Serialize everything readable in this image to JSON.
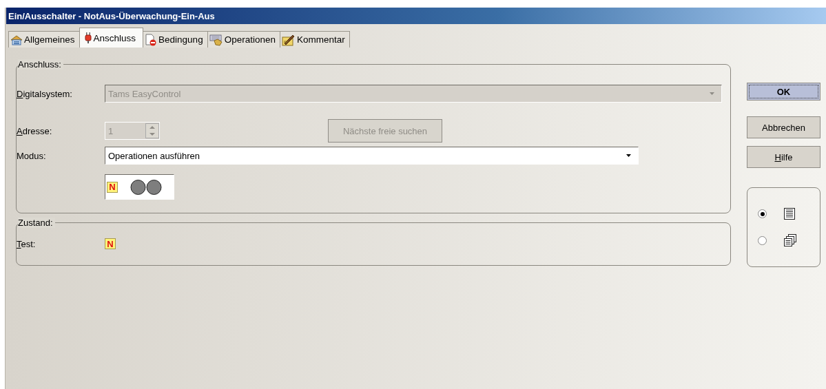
{
  "window": {
    "title": "Ein/Ausschalter - NotAus-Überwachung-Ein-Aus"
  },
  "tabs": [
    {
      "label": "Allgemeines",
      "kind": "general",
      "selected": false
    },
    {
      "label": "Anschluss",
      "kind": "plug",
      "selected": true
    },
    {
      "label": "Bedingung",
      "kind": "condition",
      "selected": false
    },
    {
      "label": "Operationen",
      "kind": "operations",
      "selected": false
    },
    {
      "label": "Kommentar",
      "kind": "comment",
      "selected": false
    }
  ],
  "connection": {
    "title": "Anschluss:",
    "digital_system": {
      "label": "Digitalsystem:",
      "underline_first": true,
      "value": "Tams EasyControl",
      "disabled": true
    },
    "address": {
      "label": "Adresse:",
      "underline_first": true,
      "value": "1",
      "disabled": true
    },
    "find_free_button": {
      "label": "Nächste freie suchen",
      "disabled": true
    },
    "mode": {
      "label": "Modus:",
      "underline_first": false,
      "value": "Operationen ausführen",
      "disabled": false
    },
    "indicator": {
      "badge": "N",
      "lamps": [
        {
          "on": false
        },
        {
          "on": false
        }
      ]
    }
  },
  "state": {
    "title": "Zustand:",
    "test": {
      "label": "Test:",
      "underline_first": true,
      "badge": "N"
    }
  },
  "buttons": [
    {
      "label": "OK",
      "default": true,
      "underline_first": false
    },
    {
      "label": "Abbrechen",
      "default": false,
      "underline_first": false
    },
    {
      "label": "Hilfe",
      "default": false,
      "underline_first": true
    }
  ],
  "view_options": [
    {
      "kind": "list",
      "selected": true
    },
    {
      "kind": "windows",
      "selected": false
    }
  ]
}
